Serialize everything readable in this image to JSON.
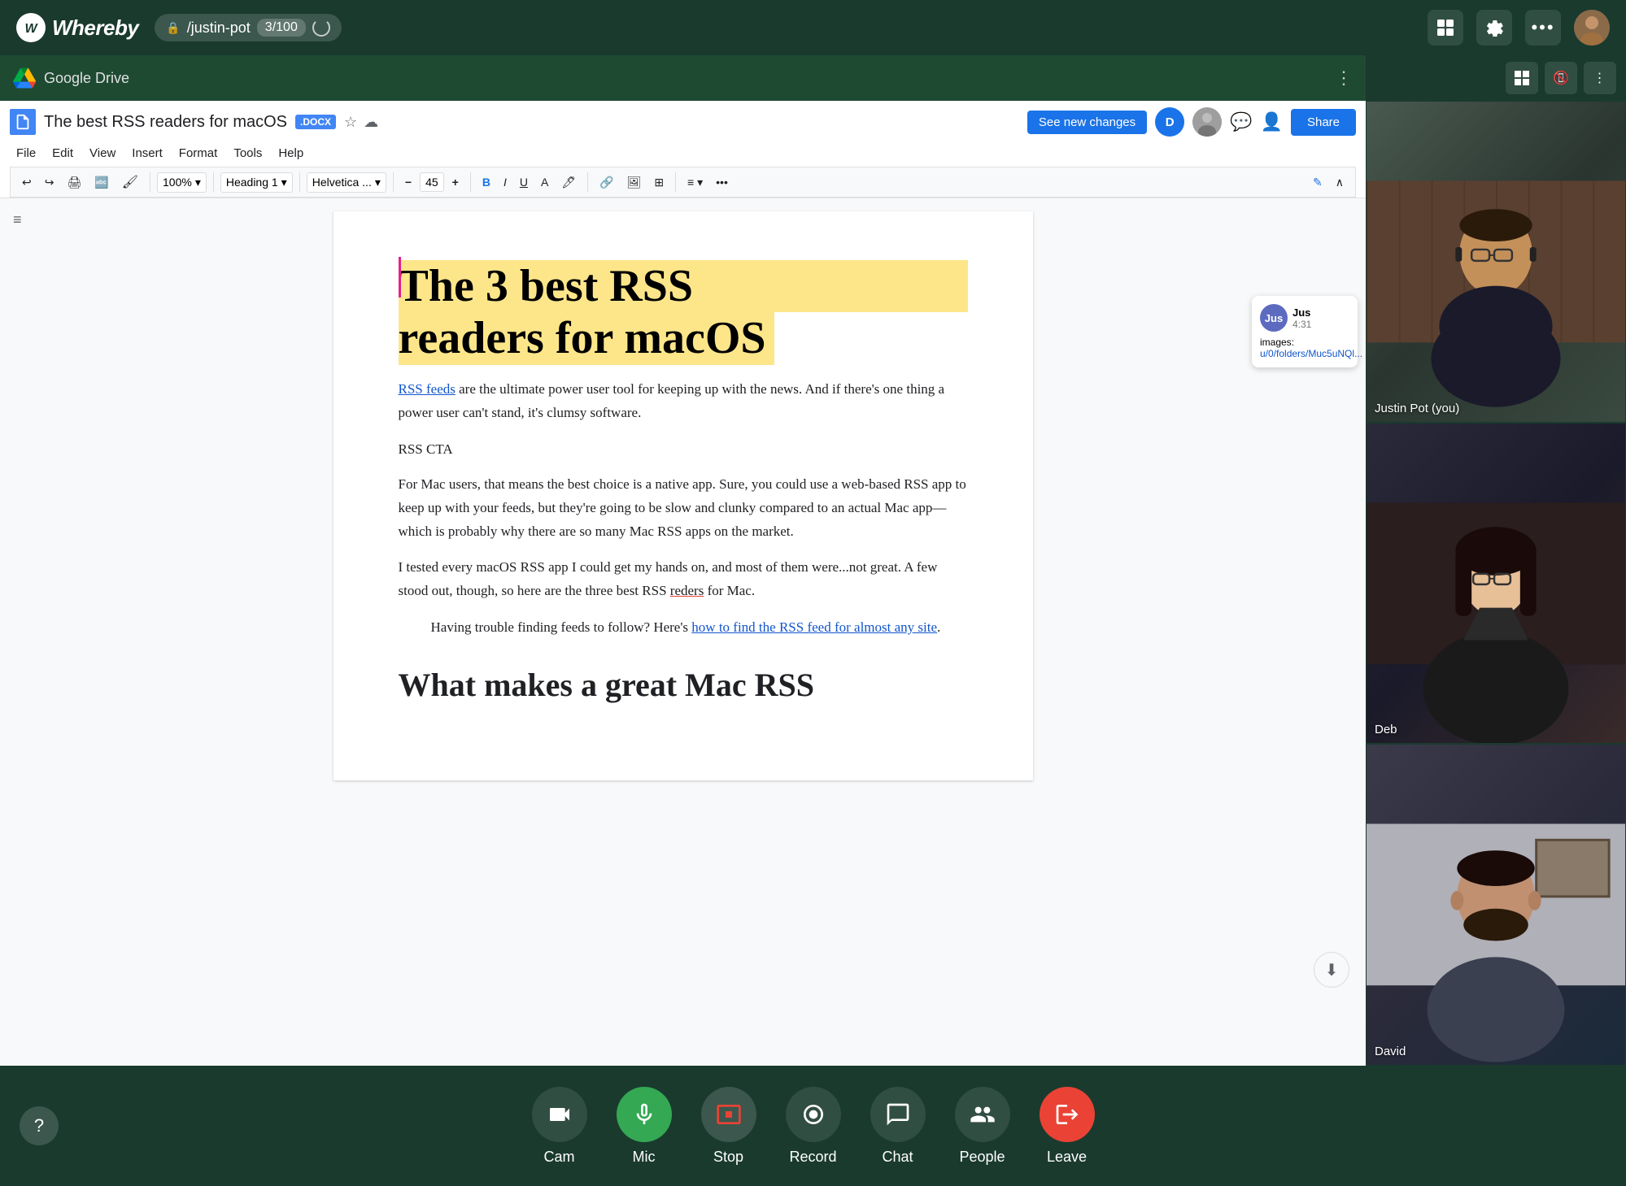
{
  "app": {
    "name": "Whereby",
    "url": "/justin-pot",
    "counter": "3/100"
  },
  "topbar": {
    "icons": [
      "grid-icon",
      "settings-icon",
      "more-icon"
    ]
  },
  "gdrive": {
    "title": "Google Drive"
  },
  "docs": {
    "title": "The best RSS readers for macOS",
    "badge": ".DOCX",
    "menu": [
      "File",
      "Edit",
      "View",
      "Insert",
      "Format",
      "Tools",
      "Help"
    ],
    "see_new_changes": "See new changes",
    "share": "Share",
    "zoom": "100%",
    "heading_style": "Heading 1",
    "font": "Helvetica ...",
    "font_size": "45",
    "toolbar_icons": [
      "undo",
      "redo",
      "print",
      "paint-format",
      "clear-formatting",
      "bold",
      "italic",
      "underline",
      "text-color",
      "highlight",
      "link",
      "image",
      "table",
      "align",
      "more"
    ],
    "heading_line1": "The 3 best RSS",
    "heading_line2": "readers for macOS",
    "body_text": {
      "rss_link": "RSS feeds",
      "para1": " are the ultimate power user tool for keeping up with the news. And if there's one thing a power user can't stand, it's clumsy software.",
      "rss_cta": "RSS CTA",
      "para2": "For Mac users, that means the best choice is a native app. Sure, you could use a web-based RSS app to keep up with your feeds, but they're going to be slow and clunky compared to an actual Mac app—which is probably why there are so many Mac RSS apps on the market.",
      "para3": "I tested every macOS RSS app I could get my hands on, and most of them were...not great. A few stood out, though, so here are the three best RSS readers for Mac.",
      "blockquote": "Having trouble finding feeds to follow? Here's ",
      "blockquote_link": "how to find the RSS feed for almost any site",
      "blockquote_end": ".",
      "h2_partial": "What makes a great Mac RSS"
    }
  },
  "chat_popup": {
    "user_initial": "Jus",
    "time": "4:31",
    "text_label": "images: ht",
    "text_link": "u/0/folders/Muc5uNQl..."
  },
  "video_participants": [
    {
      "name": "Justin Pot (you)",
      "label": "Justin Pot (you)"
    },
    {
      "name": "Deb",
      "label": "Deb"
    },
    {
      "name": "David",
      "label": "David"
    }
  ],
  "bottom_toolbar": {
    "items": [
      {
        "id": "cam",
        "label": "Cam",
        "icon": "📷"
      },
      {
        "id": "mic",
        "label": "Mic",
        "icon": "🎤",
        "active": true
      },
      {
        "id": "stop",
        "label": "Stop",
        "icon": "🖥"
      },
      {
        "id": "record",
        "label": "Record",
        "icon": "⏺"
      },
      {
        "id": "chat",
        "label": "Chat",
        "icon": "💬"
      },
      {
        "id": "people",
        "label": "People",
        "icon": "👥"
      },
      {
        "id": "leave",
        "label": "Leave",
        "icon": "🚪"
      }
    ],
    "help": "?"
  }
}
